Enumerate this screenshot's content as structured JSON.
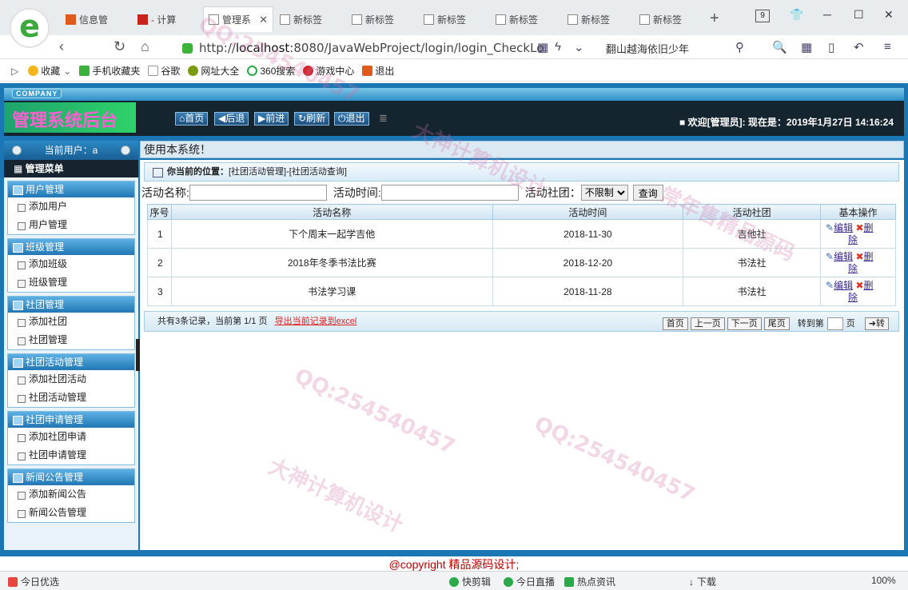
{
  "browser": {
    "tabs": [
      {
        "label": "信息管",
        "active": false
      },
      {
        "label": "- 计算",
        "active": false
      },
      {
        "label": "管理系",
        "active": true
      },
      {
        "label": "新标签",
        "active": false
      },
      {
        "label": "新标签",
        "active": false
      },
      {
        "label": "新标签",
        "active": false
      },
      {
        "label": "新标签",
        "active": false
      },
      {
        "label": "新标签",
        "active": false
      },
      {
        "label": "新标签",
        "active": false
      }
    ],
    "tab_count": "9",
    "url_prefix": "http://",
    "url_host": "localhost",
    "url_rest": ":8080/JavaWebProject/login/login_CheckLo",
    "search_keyword": "翻山越海依旧少年",
    "favorites": [
      "收藏",
      "手机收藏夹",
      "谷歌",
      "网址大全",
      "360搜索",
      "游戏中心",
      "退出"
    ]
  },
  "header": {
    "company": "COMPANY",
    "brand": "管理系统后台",
    "nav_buttons": [
      "首页",
      "后退",
      "前进",
      "刷新",
      "退出"
    ],
    "welcome": "■ 欢迎[管理员]:  现在是：2019年1月27日 14:16:24"
  },
  "sidebar": {
    "current_user": "当前用户：a",
    "menu_title": "管理菜单",
    "groups": [
      {
        "title": "用户管理",
        "items": [
          "添加用户",
          "用户管理"
        ]
      },
      {
        "title": "班级管理",
        "items": [
          "添加班级",
          "班级管理"
        ]
      },
      {
        "title": "社团管理",
        "items": [
          "添加社团",
          "社团管理"
        ]
      },
      {
        "title": "社团活动管理",
        "items": [
          "添加社团活动",
          "社团活动管理"
        ]
      },
      {
        "title": "社团申请管理",
        "items": [
          "添加社团申请",
          "社团申请管理"
        ]
      },
      {
        "title": "新闻公告管理",
        "items": [
          "添加新闻公告",
          "新闻公告管理"
        ]
      }
    ]
  },
  "marquee": "使用本系统！",
  "location": {
    "label": "你当前的位置：",
    "path": "[社团活动管理]-[社团活动查询]"
  },
  "filter": {
    "name_label": "活动名称:",
    "time_label": "活动时间:",
    "club_label": "活动社团：",
    "club_selected": "不限制",
    "query_button": "查询"
  },
  "table": {
    "headers": [
      "序号",
      "活动名称",
      "活动时间",
      "活动社团",
      "基本操作"
    ],
    "rows": [
      {
        "no": "1",
        "name": "下个周末一起学吉他",
        "time": "2018-11-30",
        "club": "吉他社"
      },
      {
        "no": "2",
        "name": "2018年冬季书法比赛",
        "time": "2018-12-20",
        "club": "书法社"
      },
      {
        "no": "3",
        "name": "书法学习课",
        "time": "2018-11-28",
        "club": "书法社"
      }
    ],
    "edit_label_1": "编辑",
    "edit_label_2": "除",
    "delete_label": "删"
  },
  "pager": {
    "summary": "共有3条记录，当前第 1/1 页",
    "export": "导出当前记录到excel",
    "first": "首页",
    "prev": "上一页",
    "next": "下一页",
    "last": "尾页",
    "goto_label": "转到第",
    "page_unit": "页",
    "go": "转"
  },
  "footer": "@copyright 精品源码设计;",
  "statusbar": {
    "left": "今日优选",
    "items": [
      "快剪辑",
      "今日直播",
      "热点资讯",
      "下载"
    ],
    "zoom": "100%"
  },
  "watermarks": [
    "QQ:254540457",
    "大神计算机设计",
    "常年售精品源码"
  ]
}
